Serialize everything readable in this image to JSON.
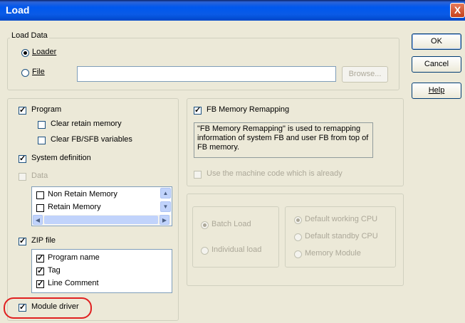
{
  "window": {
    "title": "Load",
    "close_glyph": "X"
  },
  "buttons": {
    "ok": "OK",
    "cancel": "Cancel",
    "help": "Help"
  },
  "load_data": {
    "group_label": "Load Data",
    "loader_label": "Loader",
    "file_label": "File",
    "file_value": "",
    "browse_label": "Browse..."
  },
  "left_panel": {
    "program": "Program",
    "clear_retain": "Clear retain memory",
    "clear_fb": "Clear FB/SFB variables",
    "system_definition": "System definition",
    "data": "Data",
    "data_list": [
      "Non Retain Memory",
      "Retain Memory"
    ],
    "zip_file": "ZIP file",
    "zip_list": [
      "Program name",
      "Tag",
      "Line Comment"
    ],
    "module_driver": "Module driver"
  },
  "fb_panel": {
    "remap_label": "FB Memory Remapping",
    "remap_desc": "\"FB Memory Remapping\" is used to remapping information of system FB and user FB from top of FB memory.",
    "machine_code": "Use the machine code which is already"
  },
  "cpu_panel": {
    "batch_load": "Batch Load",
    "individual_load": "Individual load",
    "default_working": "Default working CPU",
    "default_standby": "Default standby CPU",
    "memory_module": "Memory Module"
  },
  "colors": {
    "title_bar": "#0058ee",
    "dialog_bg": "#ece9d8",
    "highlight_ring": "#e02020"
  }
}
